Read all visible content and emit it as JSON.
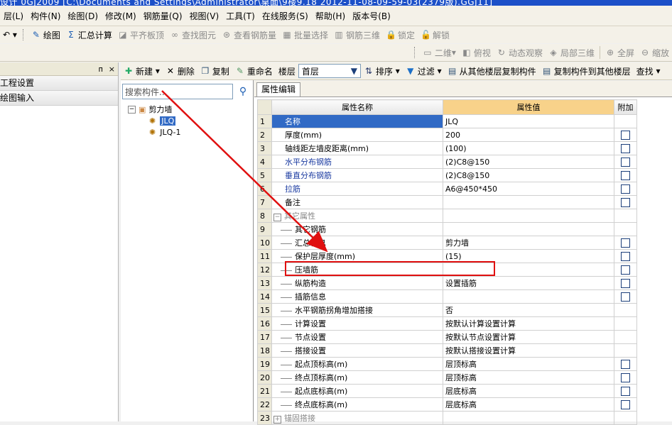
{
  "window": {
    "title": "设计 0GJ2009    [C:\\Documents and Settings\\Administrator\\桌面\\9楼9.18 2012-11-08-09-59-03(2379版).GGJ11]"
  },
  "menu": [
    "层(L)",
    "构件(N)",
    "绘图(D)",
    "修改(M)",
    "钢筋量(Q)",
    "视图(V)",
    "工具(T)",
    "在线服务(S)",
    "帮助(H)",
    "版本号(B)"
  ],
  "toolbar1": [
    {
      "label": "绘图",
      "icon": "draw-icon",
      "enabled": true
    },
    {
      "label": "汇总计算",
      "icon": "sigma-icon",
      "enabled": true
    },
    {
      "label": "平齐板顶",
      "icon": "level-icon",
      "enabled": false
    },
    {
      "label": "查找图元",
      "icon": "binoculars-icon",
      "enabled": false
    },
    {
      "label": "查看钢筋量",
      "icon": "view-rebar-icon",
      "enabled": false
    },
    {
      "label": "批量选择",
      "icon": "batch-select-icon",
      "enabled": false
    },
    {
      "label": "钢筋三维",
      "icon": "rebar-3d-icon",
      "enabled": false
    },
    {
      "label": "锁定",
      "icon": "lock-icon",
      "enabled": false
    },
    {
      "label": "解锁",
      "icon": "unlock-icon",
      "enabled": false
    }
  ],
  "toolbar2": [
    {
      "label": "二维",
      "icon": "2d-icon"
    },
    {
      "label": "俯视",
      "icon": "top-view-icon"
    },
    {
      "label": "动态观察",
      "icon": "orbit-icon"
    },
    {
      "label": "局部三维",
      "icon": "partial-3d-icon"
    },
    {
      "label": "全屏",
      "icon": "fullscreen-icon"
    },
    {
      "label": "缩放",
      "icon": "zoom-icon"
    }
  ],
  "leftpanel": {
    "pin": "ᴨ",
    "close": "×",
    "items": [
      "工程设置",
      "绘图输入"
    ]
  },
  "comptoolbar": {
    "new": "新建",
    "delete": "删除",
    "copy": "复制",
    "rename": "重命名",
    "floor_label": "楼层",
    "floor_value": "首层",
    "sort": "排序",
    "filter": "过滤",
    "copy_from": "从其他楼层复制构件",
    "copy_to": "复制构件到其他楼层",
    "find": "查找"
  },
  "search": {
    "placeholder": "搜索构件..."
  },
  "tree": {
    "root": "剪力墙",
    "children": [
      "JLQ",
      "JLQ-1"
    ]
  },
  "props": {
    "tab": "属性编辑",
    "headers": {
      "name": "属性名称",
      "value": "属性值",
      "extra": "附加"
    },
    "rows": [
      {
        "n": "1",
        "name": "名称",
        "value": "JLQ",
        "chk": false,
        "style": "selected"
      },
      {
        "n": "2",
        "name": "厚度(mm)",
        "value": "200",
        "chk": true
      },
      {
        "n": "3",
        "name": "轴线距左墙皮距离(mm)",
        "value": "(100)",
        "chk": true
      },
      {
        "n": "4",
        "name": "水平分布钢筋",
        "value": "(2)C8@150",
        "chk": true,
        "style": "blue"
      },
      {
        "n": "5",
        "name": "垂直分布钢筋",
        "value": "(2)C8@150",
        "chk": true,
        "style": "blue"
      },
      {
        "n": "6",
        "name": "拉筋",
        "value": "A6@450*450",
        "chk": true,
        "style": "blue"
      },
      {
        "n": "7",
        "name": "备注",
        "value": "",
        "chk": true
      },
      {
        "n": "8",
        "name": "其它属性",
        "value": "",
        "chk": false,
        "style": "group"
      },
      {
        "n": "9",
        "name": "其它钢筋",
        "value": "",
        "chk": false,
        "style": "child"
      },
      {
        "n": "10",
        "name": "汇总信息",
        "value": "剪力墙",
        "chk": true,
        "style": "child"
      },
      {
        "n": "11",
        "name": "保护层厚度(mm)",
        "value": "(15)",
        "chk": true,
        "style": "child"
      },
      {
        "n": "12",
        "name": "压墙筋",
        "value": "",
        "chk": true,
        "style": "child"
      },
      {
        "n": "13",
        "name": "纵筋构造",
        "value": "设置插筋",
        "chk": true,
        "style": "child"
      },
      {
        "n": "14",
        "name": "插筋信息",
        "value": "",
        "chk": true,
        "style": "child"
      },
      {
        "n": "15",
        "name": "水平钢筋拐角增加搭接",
        "value": "否",
        "chk": false,
        "style": "child"
      },
      {
        "n": "16",
        "name": "计算设置",
        "value": "按默认计算设置计算",
        "chk": false,
        "style": "child"
      },
      {
        "n": "17",
        "name": "节点设置",
        "value": "按默认节点设置计算",
        "chk": false,
        "style": "child"
      },
      {
        "n": "18",
        "name": "搭接设置",
        "value": "按默认搭接设置计算",
        "chk": false,
        "style": "child"
      },
      {
        "n": "19",
        "name": "起点顶标高(m)",
        "value": "层顶标高",
        "chk": true,
        "style": "child"
      },
      {
        "n": "20",
        "name": "终点顶标高(m)",
        "value": "层顶标高",
        "chk": true,
        "style": "child"
      },
      {
        "n": "21",
        "name": "起点底标高(m)",
        "value": "层底标高",
        "chk": true,
        "style": "child"
      },
      {
        "n": "22",
        "name": "终点底标高(m)",
        "value": "层底标高",
        "chk": true,
        "style": "child"
      },
      {
        "n": "23",
        "name": "锚固搭接",
        "value": "",
        "chk": false,
        "style": "collapsed"
      }
    ]
  },
  "colors": {
    "highlight": "#e01010",
    "selection": "#316ac5",
    "value_header": "#f8d28a"
  }
}
